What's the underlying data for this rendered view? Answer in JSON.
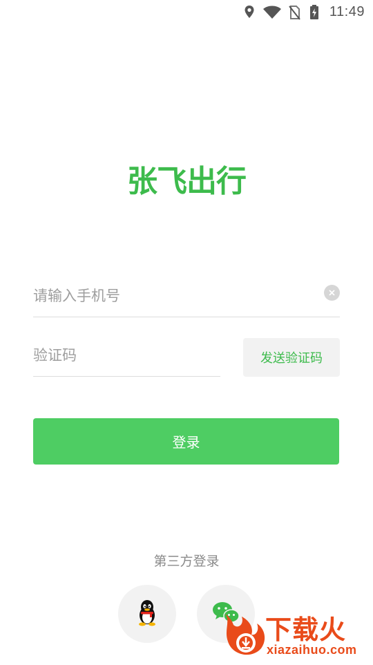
{
  "status_bar": {
    "time": "11:49",
    "icons": [
      "location-icon",
      "wifi-icon",
      "no-sim-icon",
      "battery-charging-icon"
    ]
  },
  "app": {
    "logo_text": "张飞出行",
    "brand_color": "#3dbb4c"
  },
  "form": {
    "phone_placeholder": "请输入手机号",
    "phone_value": "",
    "code_placeholder": "验证码",
    "code_value": "",
    "send_code_label": "发送验证码",
    "login_label": "登录",
    "login_button_color": "#4ecd63"
  },
  "third_party": {
    "title": "第三方登录",
    "providers": [
      "qq-icon",
      "wechat-icon"
    ]
  },
  "watermark": {
    "text": "下载火",
    "url": "xiazaihuo.com"
  }
}
